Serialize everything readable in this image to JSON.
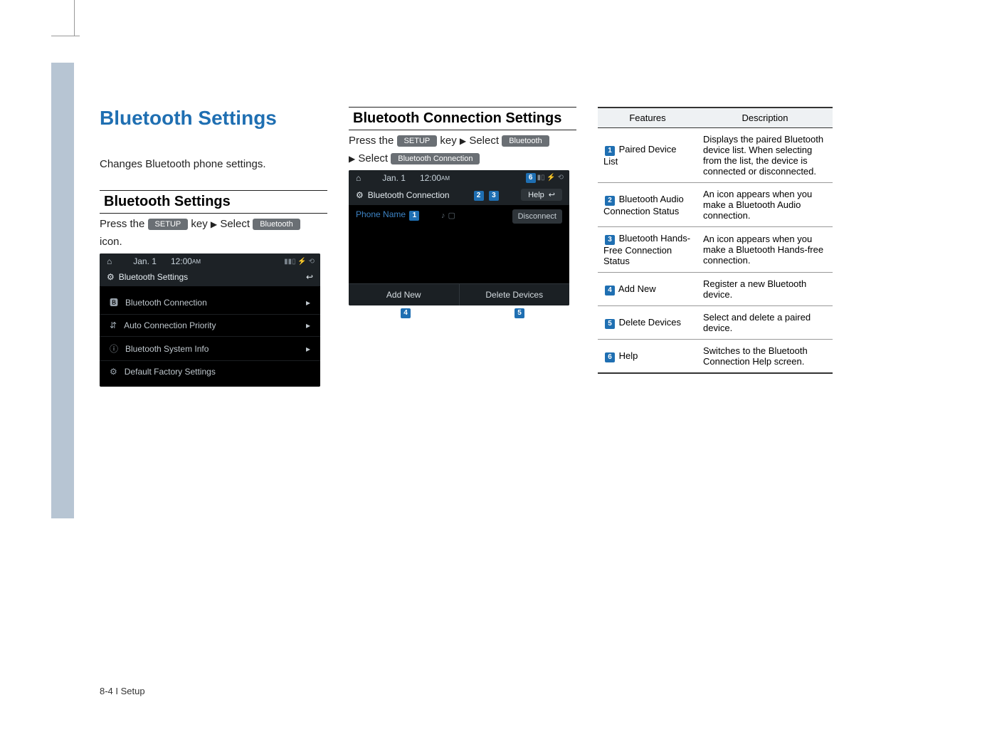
{
  "page": {
    "title": "Bluetooth Settings",
    "intro": "Changes Bluetooth phone settings.",
    "footer": "8-4 I Setup"
  },
  "left_section": {
    "heading": "Bluetooth Settings",
    "instr_prefix": "Press the",
    "setup_pill": "SETUP",
    "instr_key": "key",
    "arrow": "▶",
    "instr_select": "Select",
    "bluetooth_pill": "Bluetooth",
    "instr_suffix": "icon."
  },
  "shot1": {
    "date": "Jan.  1",
    "time": "12:00",
    "ampm": "AM",
    "title": "Bluetooth Settings",
    "items": [
      "Bluetooth Connection",
      "Auto Connection Priority",
      "Bluetooth System Info",
      "Default Factory Settings"
    ]
  },
  "mid_section": {
    "heading": "Bluetooth Connection Settings",
    "line1_prefix": "Press the",
    "setup_pill": "SETUP",
    "line1_key": "key",
    "arrow": "▶",
    "line1_select": "Select",
    "bluetooth_pill": "Bluetooth",
    "line2_arrow": "▶",
    "line2_select": "Select",
    "bt_conn_pill": "Bluetooth Connection"
  },
  "shot2": {
    "date": "Jan.  1",
    "time": "12:00",
    "ampm": "AM",
    "title": "Bluetooth Connection",
    "help": "Help",
    "phone_name": "Phone Name",
    "disconnect": "Disconnect",
    "add_new": "Add New",
    "delete_devices": "Delete Devices"
  },
  "badges": {
    "b1": "1",
    "b2": "2",
    "b3": "3",
    "b4": "4",
    "b5": "5",
    "b6": "6"
  },
  "table": {
    "head_features": "Features",
    "head_description": "Description",
    "rows": [
      {
        "num": "1",
        "feature": "Paired Device List",
        "desc": "Displays the paired Bluetooth device list. When selecting from the list, the device is connected or disconnected."
      },
      {
        "num": "2",
        "feature": "Bluetooth Audio Connection Status",
        "desc": "An icon appears when you make a Bluetooth Audio connection."
      },
      {
        "num": "3",
        "feature": "Bluetooth Hands-Free Connection Status",
        "desc": "An icon appears when you make a Bluetooth Hands-free connection."
      },
      {
        "num": "4",
        "feature": "Add New",
        "desc": "Register a new Bluetooth device."
      },
      {
        "num": "5",
        "feature": "Delete Devices",
        "desc": "Select and delete a paired device."
      },
      {
        "num": "6",
        "feature": "Help",
        "desc": "Switches to the Bluetooth Connection Help screen."
      }
    ]
  }
}
